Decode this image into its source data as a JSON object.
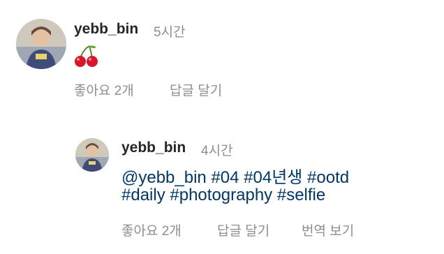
{
  "comment": {
    "username": "yebb_bin",
    "time": "5시간",
    "emoji": "cherry-emoji",
    "likes": "좋아요 2개",
    "reply": "답글 달기"
  },
  "reply_comment": {
    "username": "yebb_bin",
    "time": "4시간",
    "line1": [
      "@yebb_bin",
      "#04",
      "#04년생",
      "#ootd"
    ],
    "line2": [
      "#daily",
      "#photography",
      "#selfie"
    ],
    "likes": "좋아요 2개",
    "reply": "답글 달기",
    "translate": "번역 보기"
  },
  "colors": {
    "text": "#262626",
    "muted": "#8e8e8e",
    "link": "#00376b",
    "cherry": "#d8182a"
  }
}
